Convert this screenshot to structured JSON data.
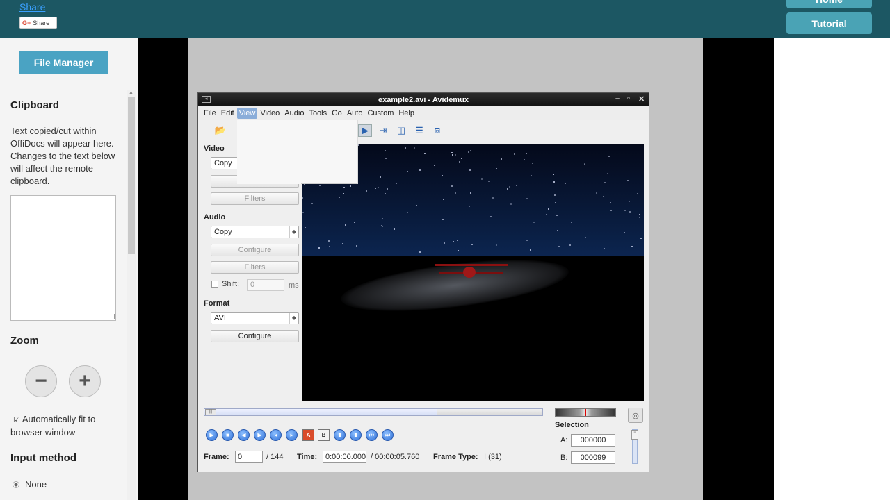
{
  "topbar": {
    "share_link": "Share",
    "gplus_share": "Share",
    "home_button": "Home",
    "tutorial_button": "Tutorial"
  },
  "sidebar": {
    "file_manager_button": "File Manager",
    "clipboard_heading": "Clipboard",
    "clipboard_text": "Text copied/cut within OffiDocs will appear here. Changes to the text below will affect the remote clipboard.",
    "clipboard_value": "",
    "zoom_heading": "Zoom",
    "zoom_out_icon": "minus-icon",
    "zoom_in_icon": "plus-icon",
    "autofit_label": "Automatically fit to browser window",
    "autofit_checked": true,
    "input_method_heading": "Input method",
    "input_method_option": "None"
  },
  "avidemux": {
    "title": "example2.avi - Avidemux",
    "menus": [
      "File",
      "Edit",
      "View",
      "Video",
      "Audio",
      "Tools",
      "Go",
      "Auto",
      "Custom",
      "Help"
    ],
    "active_menu": "View",
    "video_section": {
      "heading": "Video",
      "codec": "Copy",
      "filters_button": "Filters"
    },
    "audio_section": {
      "heading": "Audio",
      "codec": "Copy",
      "configure_button": "Configure",
      "filters_button": "Filters",
      "shift_label": "Shift:",
      "shift_value": "0",
      "shift_unit": "ms"
    },
    "format_section": {
      "heading": "Format",
      "container": "AVI",
      "configure_button": "Configure"
    },
    "status": {
      "frame_label": "Frame:",
      "frame_value": "0",
      "frame_total": "/ 144",
      "time_label": "Time:",
      "time_value": "0:00:00.000",
      "time_total": "/ 00:00:05.760",
      "frame_type_label": "Frame Type:",
      "frame_type_value": "I (31)"
    },
    "selection": {
      "heading": "Selection",
      "a_label": "A:",
      "a_value": "000000",
      "b_label": "B:",
      "b_value": "000099"
    },
    "timeline_position": 0.0,
    "icon_names": [
      "play-icon",
      "stop-icon",
      "rewind-icon",
      "forward-icon",
      "prev-frame-icon",
      "next-frame-icon",
      "marker-a-icon",
      "marker-b-icon",
      "prev-black-icon",
      "next-black-icon",
      "goto-start-icon",
      "goto-end-icon"
    ]
  },
  "colors": {
    "topbar": "#1c5763",
    "button_accent": "#4aa3c3",
    "menu_highlight": "#8aadd9"
  }
}
